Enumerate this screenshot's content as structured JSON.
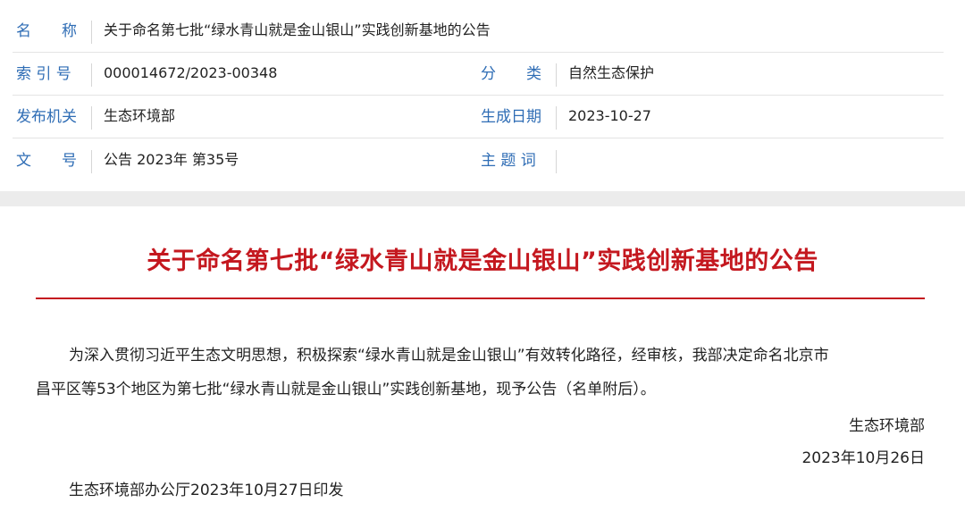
{
  "metadata": [
    {
      "label": "名　　称",
      "value": "关于命名第七批“绿水青山就是金山银山”实践创新基地的公告"
    },
    {
      "label": "索 引 号",
      "value": "000014672/2023-00348",
      "label2": "分　　类",
      "value2": "自然生态保护"
    },
    {
      "label": "发布机关",
      "value": "生态环境部",
      "label2": "生成日期",
      "value2": "2023-10-27"
    },
    {
      "label": "文　　号",
      "value": "公告 2023年 第35号",
      "label2": "主 题 词",
      "value2": ""
    }
  ],
  "article": {
    "title": "关于命名第七批“绿水青山就是金山银山”实践创新基地的公告",
    "paragraph_line1": "为深入贯彻习近平生态文明思想，积极探索“绿水青山就是金山银山”有效转化路径，经审核，我部决定命名北京市",
    "paragraph_line2": "昌平区等53个地区为第七批“绿水青山就是金山银山”实践创新基地，现予公告（名单附后）。",
    "signature": "生态环境部",
    "date": "2023年10月26日",
    "issued": "生态环境部办公厅2023年10月27日印发"
  },
  "colors": {
    "label": "#2f6db5",
    "title": "#c4181f",
    "rule": "#c4181f",
    "gap": "#ececec"
  }
}
